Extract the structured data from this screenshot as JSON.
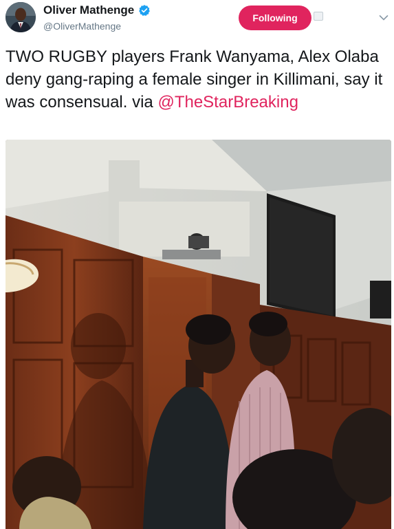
{
  "author": {
    "display_name": "Oliver Mathenge",
    "handle": "@OliverMathenge",
    "verified": true
  },
  "follow_button": {
    "label": "Following",
    "color": "#e0245e"
  },
  "tweet": {
    "text": "TWO RUGBY players Frank Wanyama, Alex Olaba deny gang-raping a female singer in Killimani, say it was consensual. via ",
    "mention": "@TheStarBreaking"
  },
  "colors": {
    "accent": "#e0245e",
    "verified": "#1da1f2",
    "muted": "#657786"
  },
  "icons": {
    "verified": "verified-badge-icon",
    "tweetdeck": "tweetdeck-icon",
    "menu": "chevron-down-icon"
  }
}
